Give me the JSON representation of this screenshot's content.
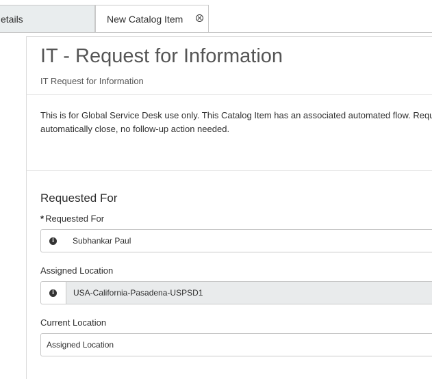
{
  "tabs": [
    {
      "label": "etails"
    },
    {
      "label": "New Catalog Item"
    }
  ],
  "page": {
    "title": "IT - Request for Information",
    "subtitle": "IT Request for Information",
    "description_line1": "This is for Global Service Desk use only. This Catalog Item has an associated automated flow. Reque",
    "description_line2": "automatically close, no follow-up action needed."
  },
  "form": {
    "section_title": "Requested For",
    "requested_for": {
      "required_mark": "*",
      "label": "Requested For",
      "value": "Subhankar Paul"
    },
    "assigned_location": {
      "label": "Assigned Location",
      "value": "USA-California-Pasadena-USPSD1"
    },
    "current_location": {
      "label": "Current Location",
      "value": "Assigned Location"
    }
  },
  "icons": {
    "info": "info-icon",
    "close": "close-icon"
  },
  "colors": {
    "tab_inactive_bg": "#e9edee",
    "readonly_bg": "#e9ebec",
    "title_color": "#555555"
  }
}
